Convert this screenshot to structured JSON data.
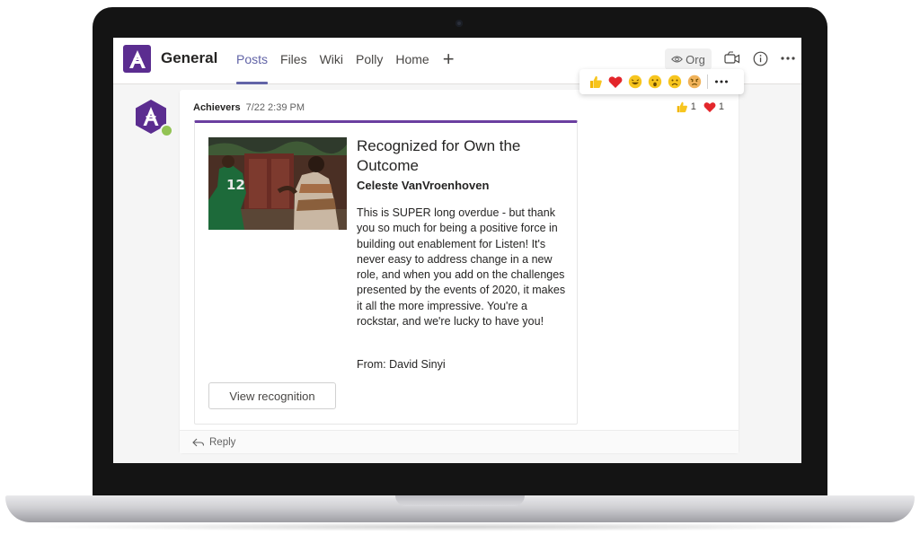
{
  "header": {
    "channel_title": "General",
    "tabs": [
      {
        "label": "Posts",
        "active": true
      },
      {
        "label": "Files",
        "active": false
      },
      {
        "label": "Wiki",
        "active": false
      },
      {
        "label": "Polly",
        "active": false
      },
      {
        "label": "Home",
        "active": false
      }
    ],
    "add_tab_icon": "plus-icon",
    "org_label": "Org",
    "icons": [
      "eye-icon",
      "video-call-icon",
      "info-icon",
      "more-options-icon"
    ]
  },
  "reaction_bar": {
    "reactions": [
      "like",
      "heart",
      "laugh",
      "surprised",
      "sad",
      "angry"
    ],
    "more_icon": "more-options-icon"
  },
  "post": {
    "author": "Achievers",
    "timestamp": "7/22 2:39 PM",
    "reactions": [
      {
        "type": "like",
        "count": "1"
      },
      {
        "type": "heart",
        "count": "1"
      }
    ],
    "card": {
      "title": "Recognized for Own the Outcome",
      "recipient": "Celeste VanVroenhoven",
      "message": "This is SUPER long overdue - but thank you so much for being a positive force in building out enablement for Listen! It's never easy to address change in a new role, and when you add on the challenges presented by the events of 2020, it makes it all the more impressive. You're a rockstar, and we're lucky to have you!",
      "from": "From: David Sinyi",
      "button_label": "View recognition"
    },
    "reply_label": "Reply"
  },
  "colors": {
    "brand_purple": "#5b2d90",
    "accent": "#6264a7",
    "card_border": "#6b3fa0",
    "presence": "#92c353",
    "heart": "#e3262b"
  }
}
